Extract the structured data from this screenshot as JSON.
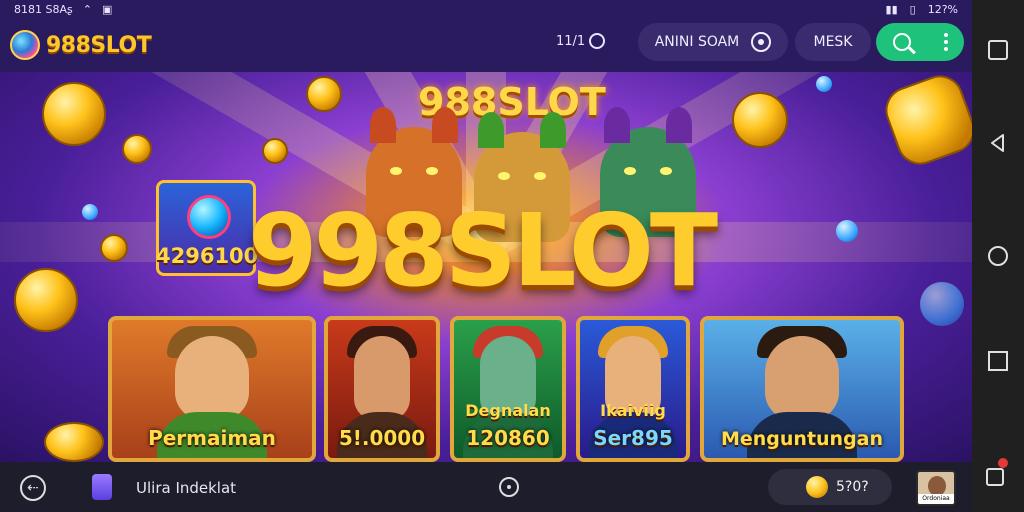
{
  "status_bar": {
    "left_text": "8181 S8Aʂ",
    "battery": "12?%"
  },
  "header": {
    "logo": "988SLOT",
    "indicator": "11/1",
    "user_label": "ANINI SOAM",
    "masuk_label": "MESK"
  },
  "hero": {
    "title_small": "988SLOT",
    "title_big": "998SLOT",
    "jackpot": "4296100",
    "cards": [
      {
        "label": "Permaiman",
        "sublabel": ""
      },
      {
        "label": "5!.0000",
        "sublabel": ""
      },
      {
        "label": "120860",
        "sublabel": "Degnalan"
      },
      {
        "label": "Ser895",
        "sublabel": "Ikaiviig"
      },
      {
        "label": "Menguntungan",
        "sublabel": ""
      }
    ]
  },
  "bottom_bar": {
    "label": "Ulira Indeklat",
    "balance": "5?0?",
    "avatar_tag": "Ordoniaa"
  },
  "colors": {
    "header_bg": "#2a1a5e",
    "accent_green": "#1ec27a",
    "gold": "#ffcc2e"
  },
  "icons": [
    "wifi-icon",
    "chart-icon",
    "camera-icon",
    "search-icon",
    "more-vert-icon",
    "back-icon",
    "gift-icon",
    "home-indicator-icon",
    "coin-icon",
    "rotate-icon",
    "nav-back-icon",
    "nav-home-icon",
    "nav-recent-icon",
    "notification-icon"
  ]
}
